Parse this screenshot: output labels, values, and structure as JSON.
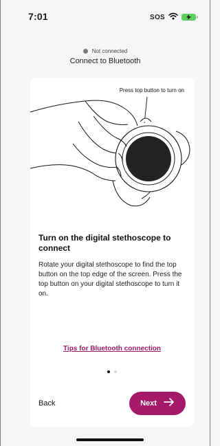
{
  "status_bar": {
    "time": "7:01",
    "sos": "SOS",
    "icons": [
      "wifi-icon",
      "battery-charging-icon"
    ]
  },
  "connection": {
    "status": "Not connected",
    "title": "Connect to Bluetooth"
  },
  "card": {
    "illustration_caption": "Press top button to turn on",
    "heading": "Turn on the digital stethoscope to connect",
    "body": "Rotate your digital stethoscope to find the top button on the top edge of the screen. Press the top button on your digital stethoscope to turn it on.",
    "tips_link": "Tips for Bluetooth connection",
    "pager": {
      "current": 1,
      "total": 2
    }
  },
  "nav": {
    "back_label": "Back",
    "next_label": "Next",
    "next_icon": "arrow-right-icon"
  },
  "colors": {
    "accent": "#a5186a",
    "link": "#9b1c6a",
    "background": "#f6f6f8",
    "card": "#ffffff",
    "battery": "#5bd15c"
  }
}
